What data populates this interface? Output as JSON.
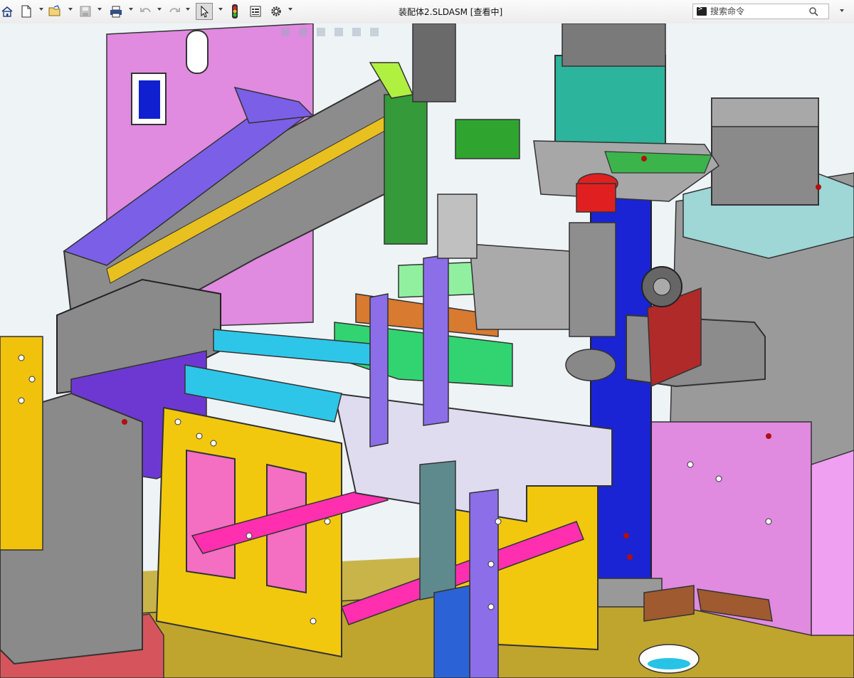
{
  "window": {
    "title": "装配体2.SLDASM [查看中]"
  },
  "toolbar": {
    "items": [
      {
        "icon": "home-icon"
      },
      {
        "icon": "new-document-icon"
      },
      {
        "icon": "open-folder-icon"
      },
      {
        "icon": "save-icon"
      },
      {
        "icon": "print-icon"
      },
      {
        "icon": "undo-icon"
      },
      {
        "icon": "redo-icon"
      },
      {
        "icon": "select-pointer-icon"
      },
      {
        "icon": "traffic-light-icon"
      },
      {
        "icon": "file-properties-icon"
      },
      {
        "icon": "options-gear-icon"
      }
    ]
  },
  "search": {
    "placeholder": "搜索命令"
  },
  "colors": {
    "accent": "#ffd21e",
    "violet": "#7f5fe6",
    "magenta": "#e083e0",
    "blue": "#1f2fd9",
    "pink": "#ff3fb3",
    "grey": "#808080",
    "green": "#3dd45a"
  }
}
